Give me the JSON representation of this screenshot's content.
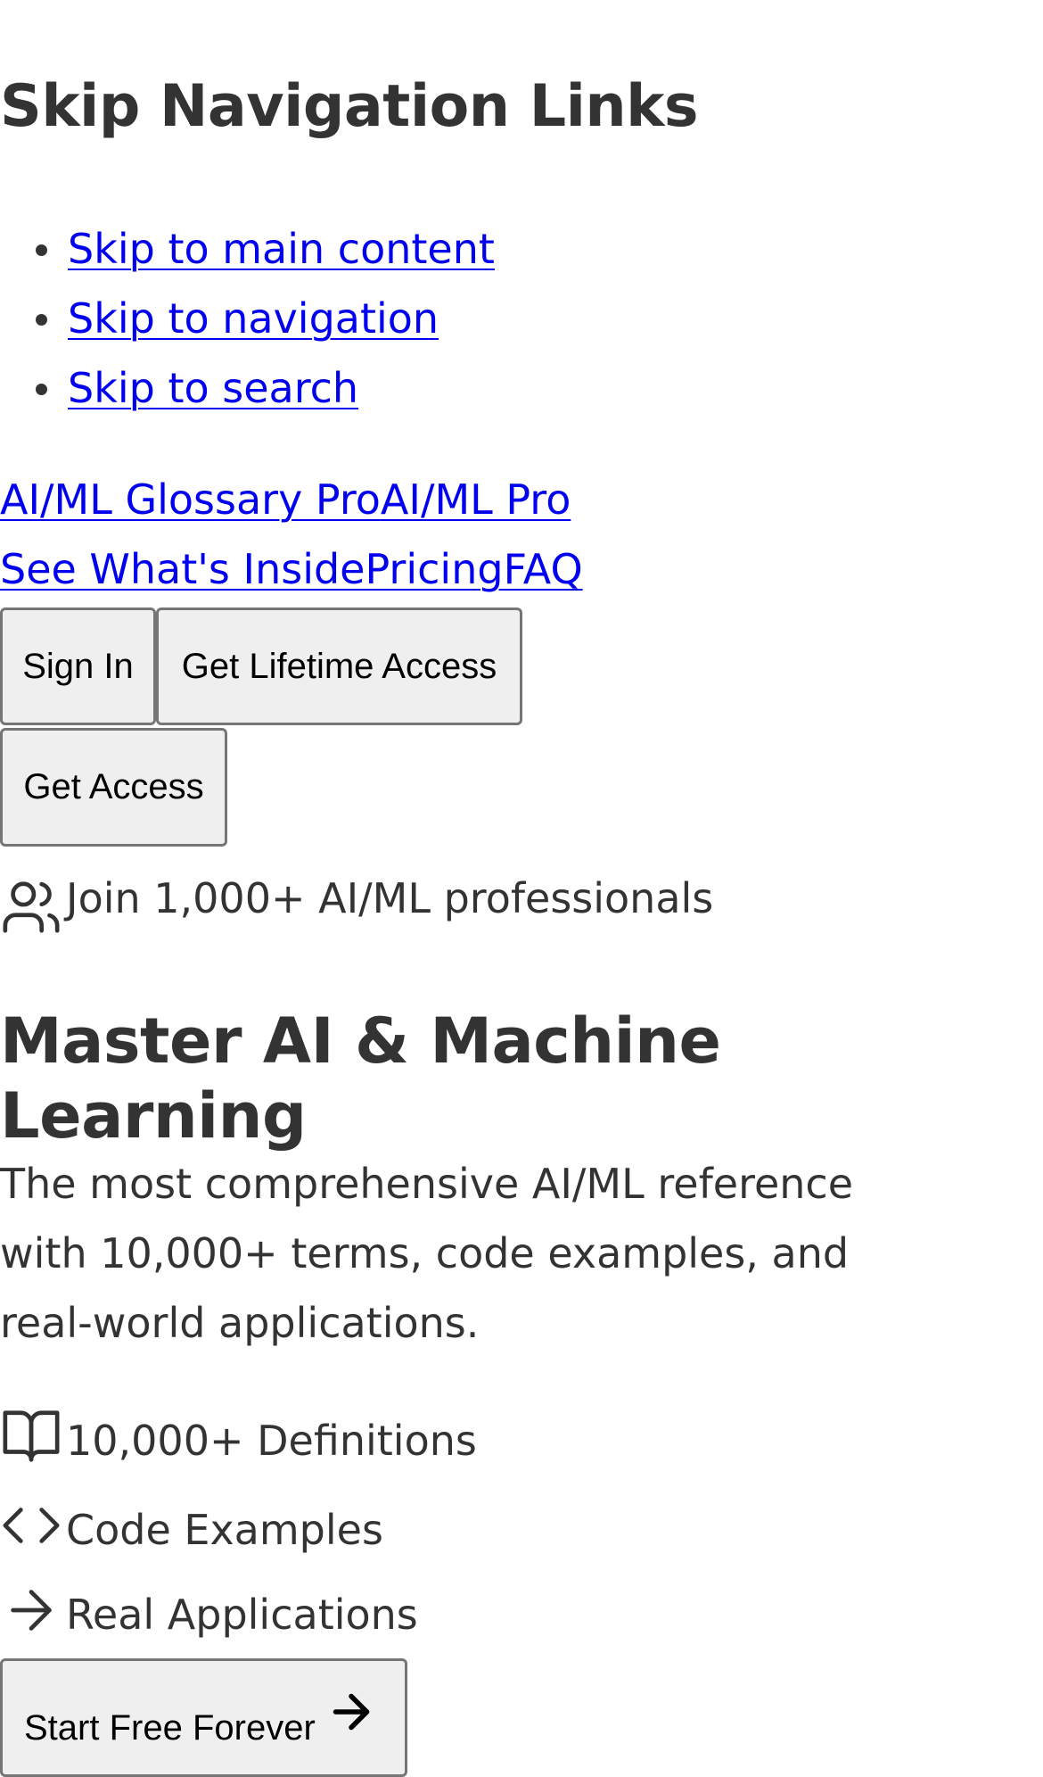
{
  "skip_nav": {
    "heading": "Skip Navigation Links",
    "links": [
      {
        "label": "Skip to main content"
      },
      {
        "label": "Skip to navigation"
      },
      {
        "label": "Skip to search"
      }
    ]
  },
  "brand": {
    "logo_link": "AI/ML Glossary Pro",
    "pro_link": "AI/ML Pro"
  },
  "nav": {
    "inside": "See What's Inside",
    "pricing": "Pricing",
    "faq": "FAQ"
  },
  "header_buttons": {
    "sign_in": "Sign In",
    "lifetime": "Get Lifetime Access",
    "access": "Get Access"
  },
  "social_proof": {
    "icon": "users-icon",
    "text": "Join 1,000+ AI/ML professionals"
  },
  "hero": {
    "title": "Master AI & Machine Learning",
    "description": "The most comprehensive AI/ML reference with 10,000+ terms, code examples, and real-world applications."
  },
  "features": [
    {
      "icon": "book-open-icon",
      "label": "10,000+ Definitions"
    },
    {
      "icon": "code-icon",
      "label": "Code Examples"
    },
    {
      "icon": "arrow-right-icon",
      "label": "Real Applications"
    }
  ],
  "cta": {
    "label": "Start Free Forever",
    "icon": "arrow-right-icon"
  },
  "colors": {
    "link": "#0000ee",
    "text": "#333333",
    "button_bg": "#efefef",
    "button_border": "#767676"
  }
}
